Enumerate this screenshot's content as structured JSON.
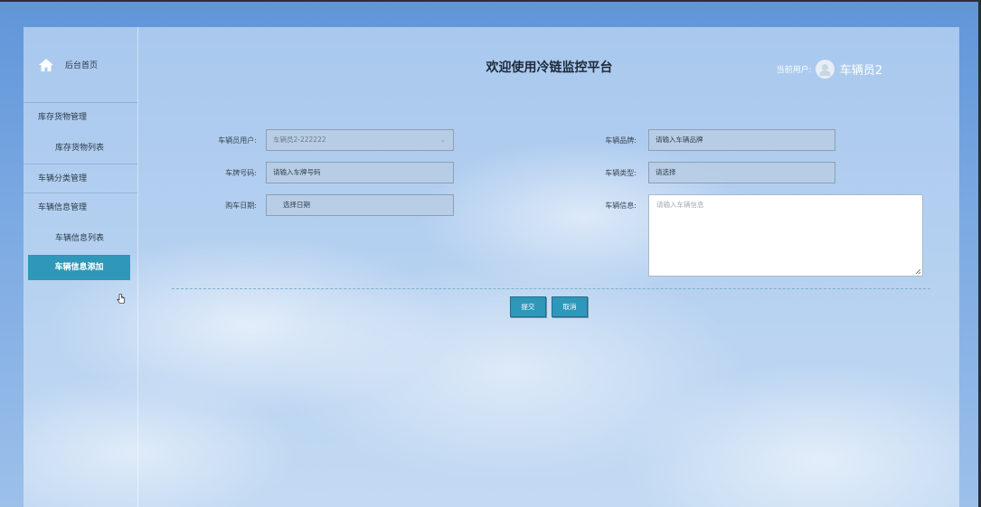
{
  "sidebar": {
    "home_label": "后台首页",
    "groups": [
      {
        "title": "库存货物管理",
        "items": [
          "库存货物列表"
        ]
      },
      {
        "title": "车辆分类管理",
        "items": []
      },
      {
        "title": "车辆信息管理",
        "items": [
          "车辆信息列表",
          "车辆信息添加"
        ]
      }
    ],
    "active_item": "车辆信息添加"
  },
  "header": {
    "title": "欢迎使用冷链监控平台",
    "current_user_prefix": "当前用户:",
    "current_user_name": "车辆员2"
  },
  "form": {
    "vehicle_user_label": "车辆员用户:",
    "vehicle_user_value": "车辆员2-222222",
    "plate_label": "车牌号码:",
    "plate_placeholder": "请输入车牌号码",
    "purchase_date_label": "购车日期:",
    "purchase_date_placeholder": "选择日期",
    "brand_label": "车辆品牌:",
    "brand_placeholder": "请输入车辆品牌",
    "type_label": "车辆类型:",
    "type_placeholder": "请选择",
    "info_label": "车辆信息:",
    "info_placeholder": "请输入车辆信息"
  },
  "actions": {
    "submit_label": "提交",
    "cancel_label": "取消"
  },
  "colors": {
    "accent": "#2f97b9",
    "background": "#7aa8e2"
  }
}
